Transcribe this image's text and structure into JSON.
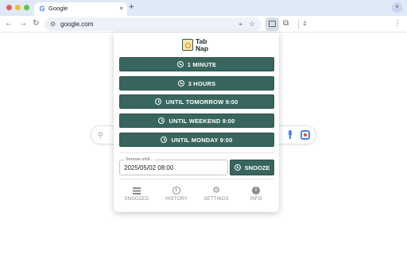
{
  "browser": {
    "tab_title": "Google",
    "tab_favicon": "G",
    "new_tab": "+",
    "address": "google.com",
    "tab_close": "×",
    "tab_menu": "˅"
  },
  "popup": {
    "logo_line1": "Tab",
    "logo_line2": "Nap",
    "buttons": [
      {
        "label": "1 MINUTE"
      },
      {
        "label": "3 HOURS"
      },
      {
        "label": "UNTIL TOMORROW 9:00"
      },
      {
        "label": "UNTIL WEEKEND 9:00"
      },
      {
        "label": "UNTIL MONDAY 9:00"
      }
    ],
    "snooze_field_label": "Snooze until...",
    "snooze_field_value": "2025/05/02 08:00",
    "snooze_button": "SNOOZE",
    "nav": [
      {
        "label": "SNOOZED",
        "icon": "list-icon"
      },
      {
        "label": "HISTORY",
        "icon": "history-icon"
      },
      {
        "label": "SETTINGS",
        "icon": "gear-icon"
      },
      {
        "label": "INFO",
        "icon": "info-icon"
      }
    ]
  },
  "colors": {
    "accent": "#38665e",
    "tabbar": "#dfe9f7",
    "nav_icon": "#8a8a8a"
  }
}
